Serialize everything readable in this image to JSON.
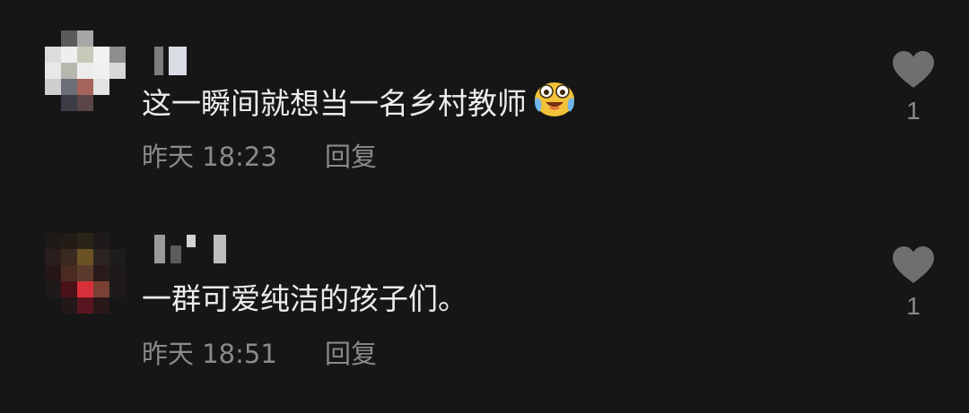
{
  "comments": [
    {
      "text": "这一瞬间就想当一名乡村教师",
      "emoji": "crying-laughing-emoji",
      "time": "昨天 18:23",
      "reply_label": "回复",
      "like_count": "1",
      "like_icon": "heart-icon"
    },
    {
      "text": "一群可爱纯洁的孩子们。",
      "time": "昨天 18:51",
      "reply_label": "回复",
      "like_count": "1",
      "like_icon": "heart-icon"
    }
  ],
  "colors": {
    "background": "#161616",
    "text": "#ececec",
    "meta": "#8a8a8a",
    "heart": "#6f6f6f"
  }
}
